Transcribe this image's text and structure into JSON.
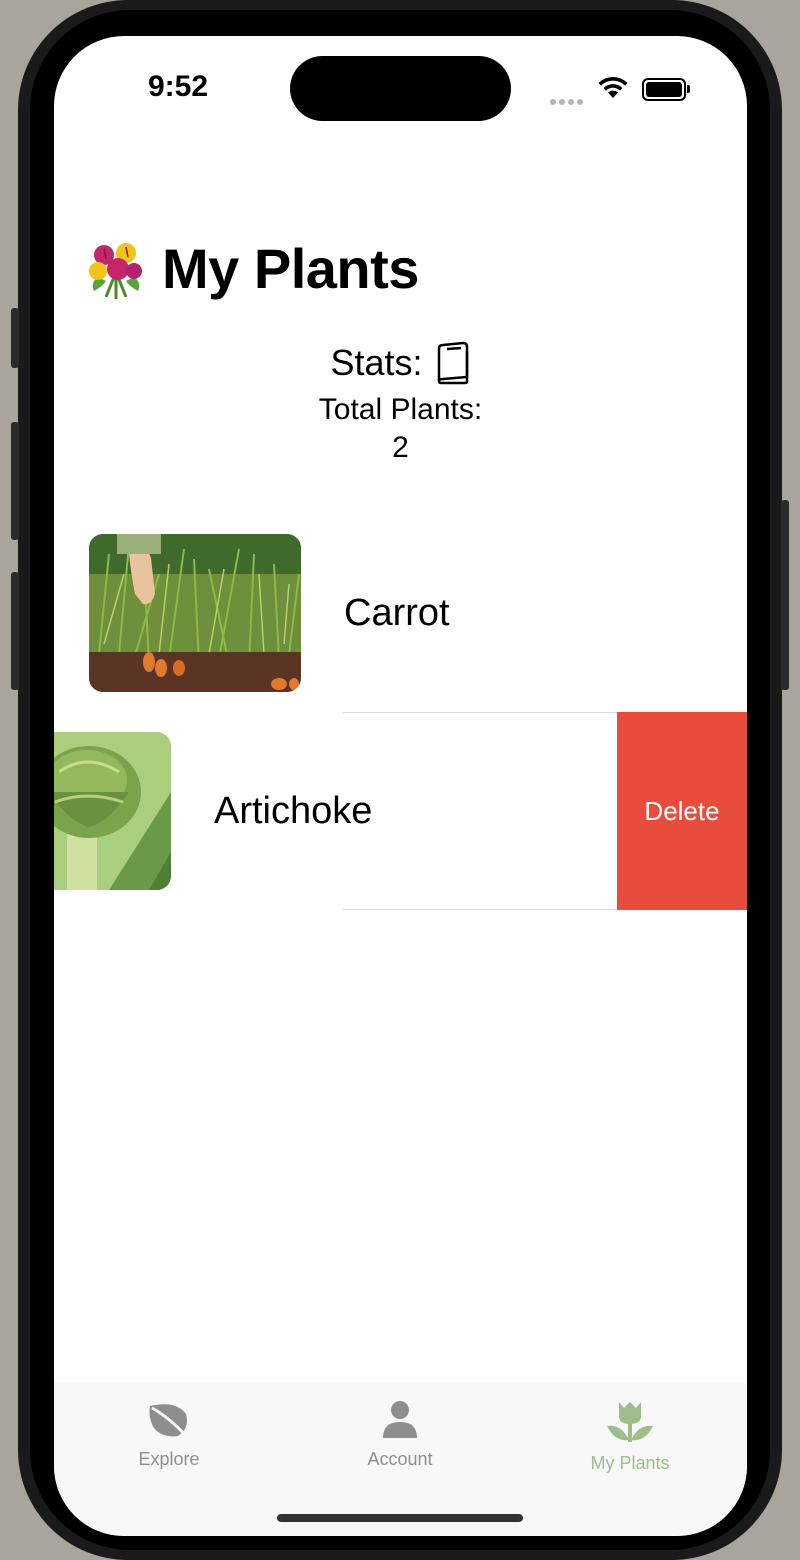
{
  "status_bar": {
    "time": "9:52"
  },
  "header": {
    "title": "My Plants",
    "icon": "bouquet-emoji"
  },
  "stats": {
    "label": "Stats:",
    "icon": "book-icon",
    "total_label": "Total Plants:",
    "total_value": "2"
  },
  "plants": [
    {
      "name": "Carrot",
      "image": "carrot-photo"
    },
    {
      "name": "Artichoke",
      "image": "artichoke-photo"
    }
  ],
  "swipe_action": {
    "label": "Delete",
    "color": "#e84c3d"
  },
  "tabs": [
    {
      "label": "Explore",
      "icon": "leaf-icon",
      "active": false
    },
    {
      "label": "Account",
      "icon": "person-icon",
      "active": false
    },
    {
      "label": "My Plants",
      "icon": "tulip-icon",
      "active": true
    }
  ],
  "colors": {
    "active_tab": "#9dbe8a",
    "inactive_tab": "#8e8e8e",
    "delete": "#e84c3d"
  }
}
